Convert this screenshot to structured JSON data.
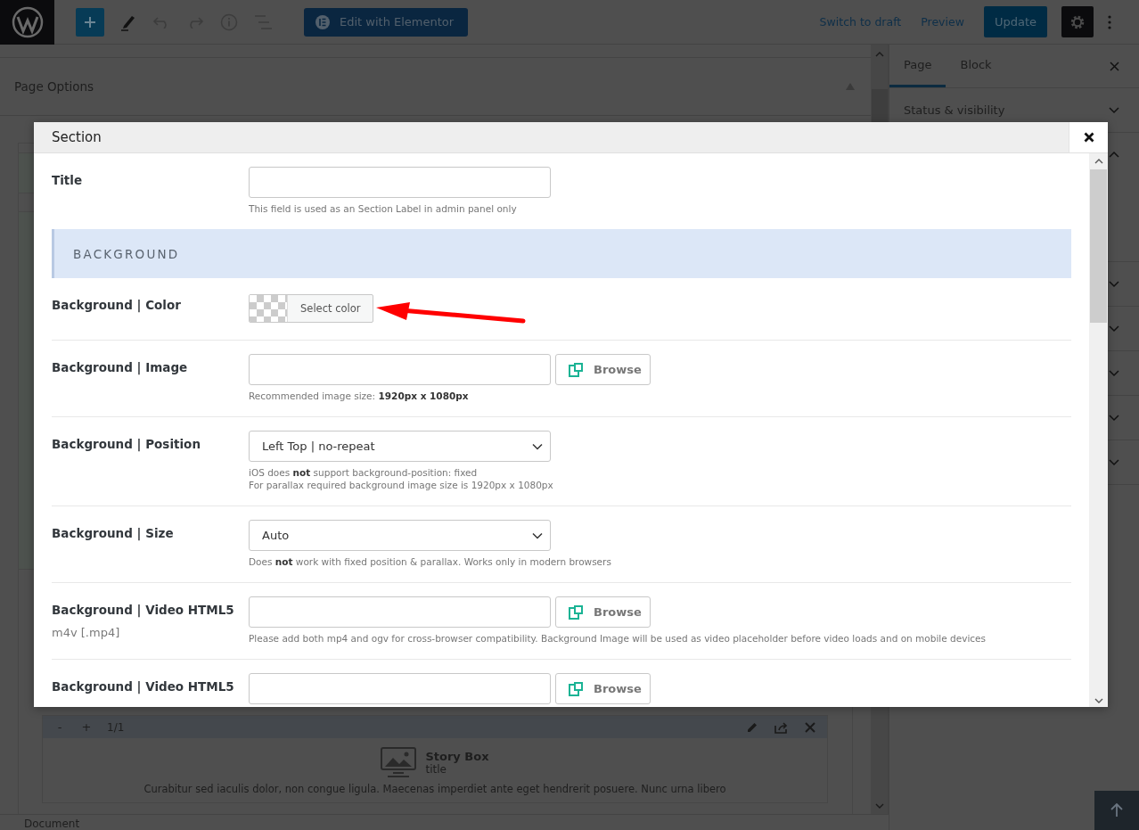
{
  "toolbar": {
    "edit_button": "Edit with Elementor",
    "links": [
      "Switch to draft",
      "Preview"
    ],
    "update_button": "Update"
  },
  "page_options": {
    "title": "Page Options"
  },
  "story_box": {
    "minus": "-",
    "plus": "+",
    "counter": "1/1",
    "title": "Story Box",
    "subtitle": "title",
    "text": "Curabitur sed iaculis dolor, non congue ligula. Maecenas imperdiet ante eget hendrerit posuere. Nunc urna libero"
  },
  "footer": {
    "label": "Document"
  },
  "sidebar": {
    "tabs": [
      {
        "label": "Page",
        "selected": true
      },
      {
        "label": "Block",
        "selected": false
      }
    ],
    "panels": [
      {
        "title": "Status & visibility",
        "expanded": false
      },
      {
        "expanded": true
      },
      {
        "expanded": false
      },
      {
        "expanded": false
      },
      {
        "expanded": false
      },
      {
        "expanded": false
      },
      {
        "expanded": false
      }
    ]
  },
  "modal": {
    "title": "Section",
    "fields": [
      {
        "kind": "text",
        "label": "Title",
        "help": [
          "This field is used as an Section Label in admin panel only"
        ]
      },
      {
        "kind": "heading",
        "label": "BACKGROUND"
      },
      {
        "kind": "color",
        "label": "Background | Color",
        "button": "Select color"
      },
      {
        "kind": "file",
        "label": "Background | Image",
        "button": "Browse",
        "help": [
          "Recommended image size: **1920px x 1080px**"
        ]
      },
      {
        "kind": "select",
        "label": "Background | Position",
        "value": "Left Top | no-repeat",
        "help": [
          "iOS does **not** support background-position: fixed",
          "For parallax required background image size is 1920px x 1080px"
        ]
      },
      {
        "kind": "select",
        "label": "Background | Size",
        "value": "Auto",
        "help": [
          "Does **not** work with fixed position & parallax. Works only in modern browsers"
        ]
      },
      {
        "kind": "file",
        "label": "Background | Video HTML5",
        "sublabel": "m4v [.mp4]",
        "button": "Browse",
        "help": [
          "Please add both mp4 and ogv for cross-browser compatibility. Background Image will be used as video placeholder before video loads and on mobile devices"
        ]
      },
      {
        "kind": "file",
        "label": "Background | Video HTML5",
        "button": "Browse"
      }
    ]
  }
}
